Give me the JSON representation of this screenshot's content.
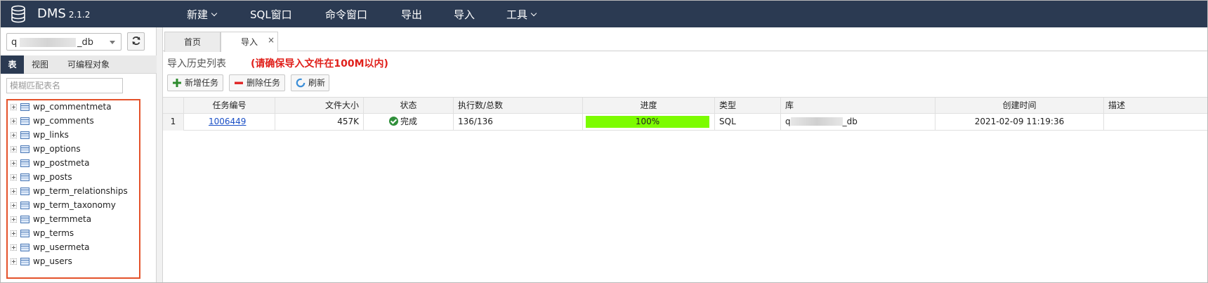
{
  "app": {
    "brand": "DMS",
    "version": "2.1.2",
    "menu": [
      {
        "label": "新建",
        "has_dropdown": true
      },
      {
        "label": "SQL窗口",
        "has_dropdown": false
      },
      {
        "label": "命令窗口",
        "has_dropdown": false
      },
      {
        "label": "导出",
        "has_dropdown": false
      },
      {
        "label": "导入",
        "has_dropdown": false
      },
      {
        "label": "工具",
        "has_dropdown": true
      }
    ]
  },
  "sidebar": {
    "db_select": {
      "prefix": "q",
      "suffix": "_db"
    },
    "refresh_icon": "refresh-icon",
    "tabs": [
      "表",
      "视图",
      "可编程对象"
    ],
    "active_tab": "表",
    "filter_placeholder": "模糊匹配表名",
    "tables": [
      "wp_commentmeta",
      "wp_comments",
      "wp_links",
      "wp_options",
      "wp_postmeta",
      "wp_posts",
      "wp_term_relationships",
      "wp_term_taxonomy",
      "wp_termmeta",
      "wp_terms",
      "wp_usermeta",
      "wp_users"
    ]
  },
  "main": {
    "tabs": [
      {
        "label": "首页",
        "closable": false
      },
      {
        "label": "导入",
        "closable": true,
        "active": true
      }
    ],
    "close_glyph": "×",
    "title": "导入历史列表",
    "warning": "(请确保导入文件在100M以内)",
    "toolbar": {
      "add_label": "新增任务",
      "delete_label": "删除任务",
      "refresh_label": "刷新"
    },
    "table": {
      "columns": [
        "任务编号",
        "文件大小",
        "状态",
        "执行数/总数",
        "进度",
        "类型",
        "库",
        "创建时间",
        "描述"
      ],
      "rows": [
        {
          "index": "1",
          "task_id": "1006449",
          "file_size": "457K",
          "status": "完成",
          "exec": "136/136",
          "progress_percent": 100,
          "progress_label": "100%",
          "type": "SQL",
          "db_prefix": "q",
          "db_suffix": "_db",
          "created": "2021-02-09 11:19:36",
          "desc": ""
        }
      ]
    }
  },
  "colors": {
    "topbar": "#2b3a52",
    "highlight_border": "#e4522a",
    "warning_text": "#e0201b",
    "progress_fill": "#7cfc00",
    "link": "#1a4fc6",
    "status_ok": "#2f8f3a"
  }
}
